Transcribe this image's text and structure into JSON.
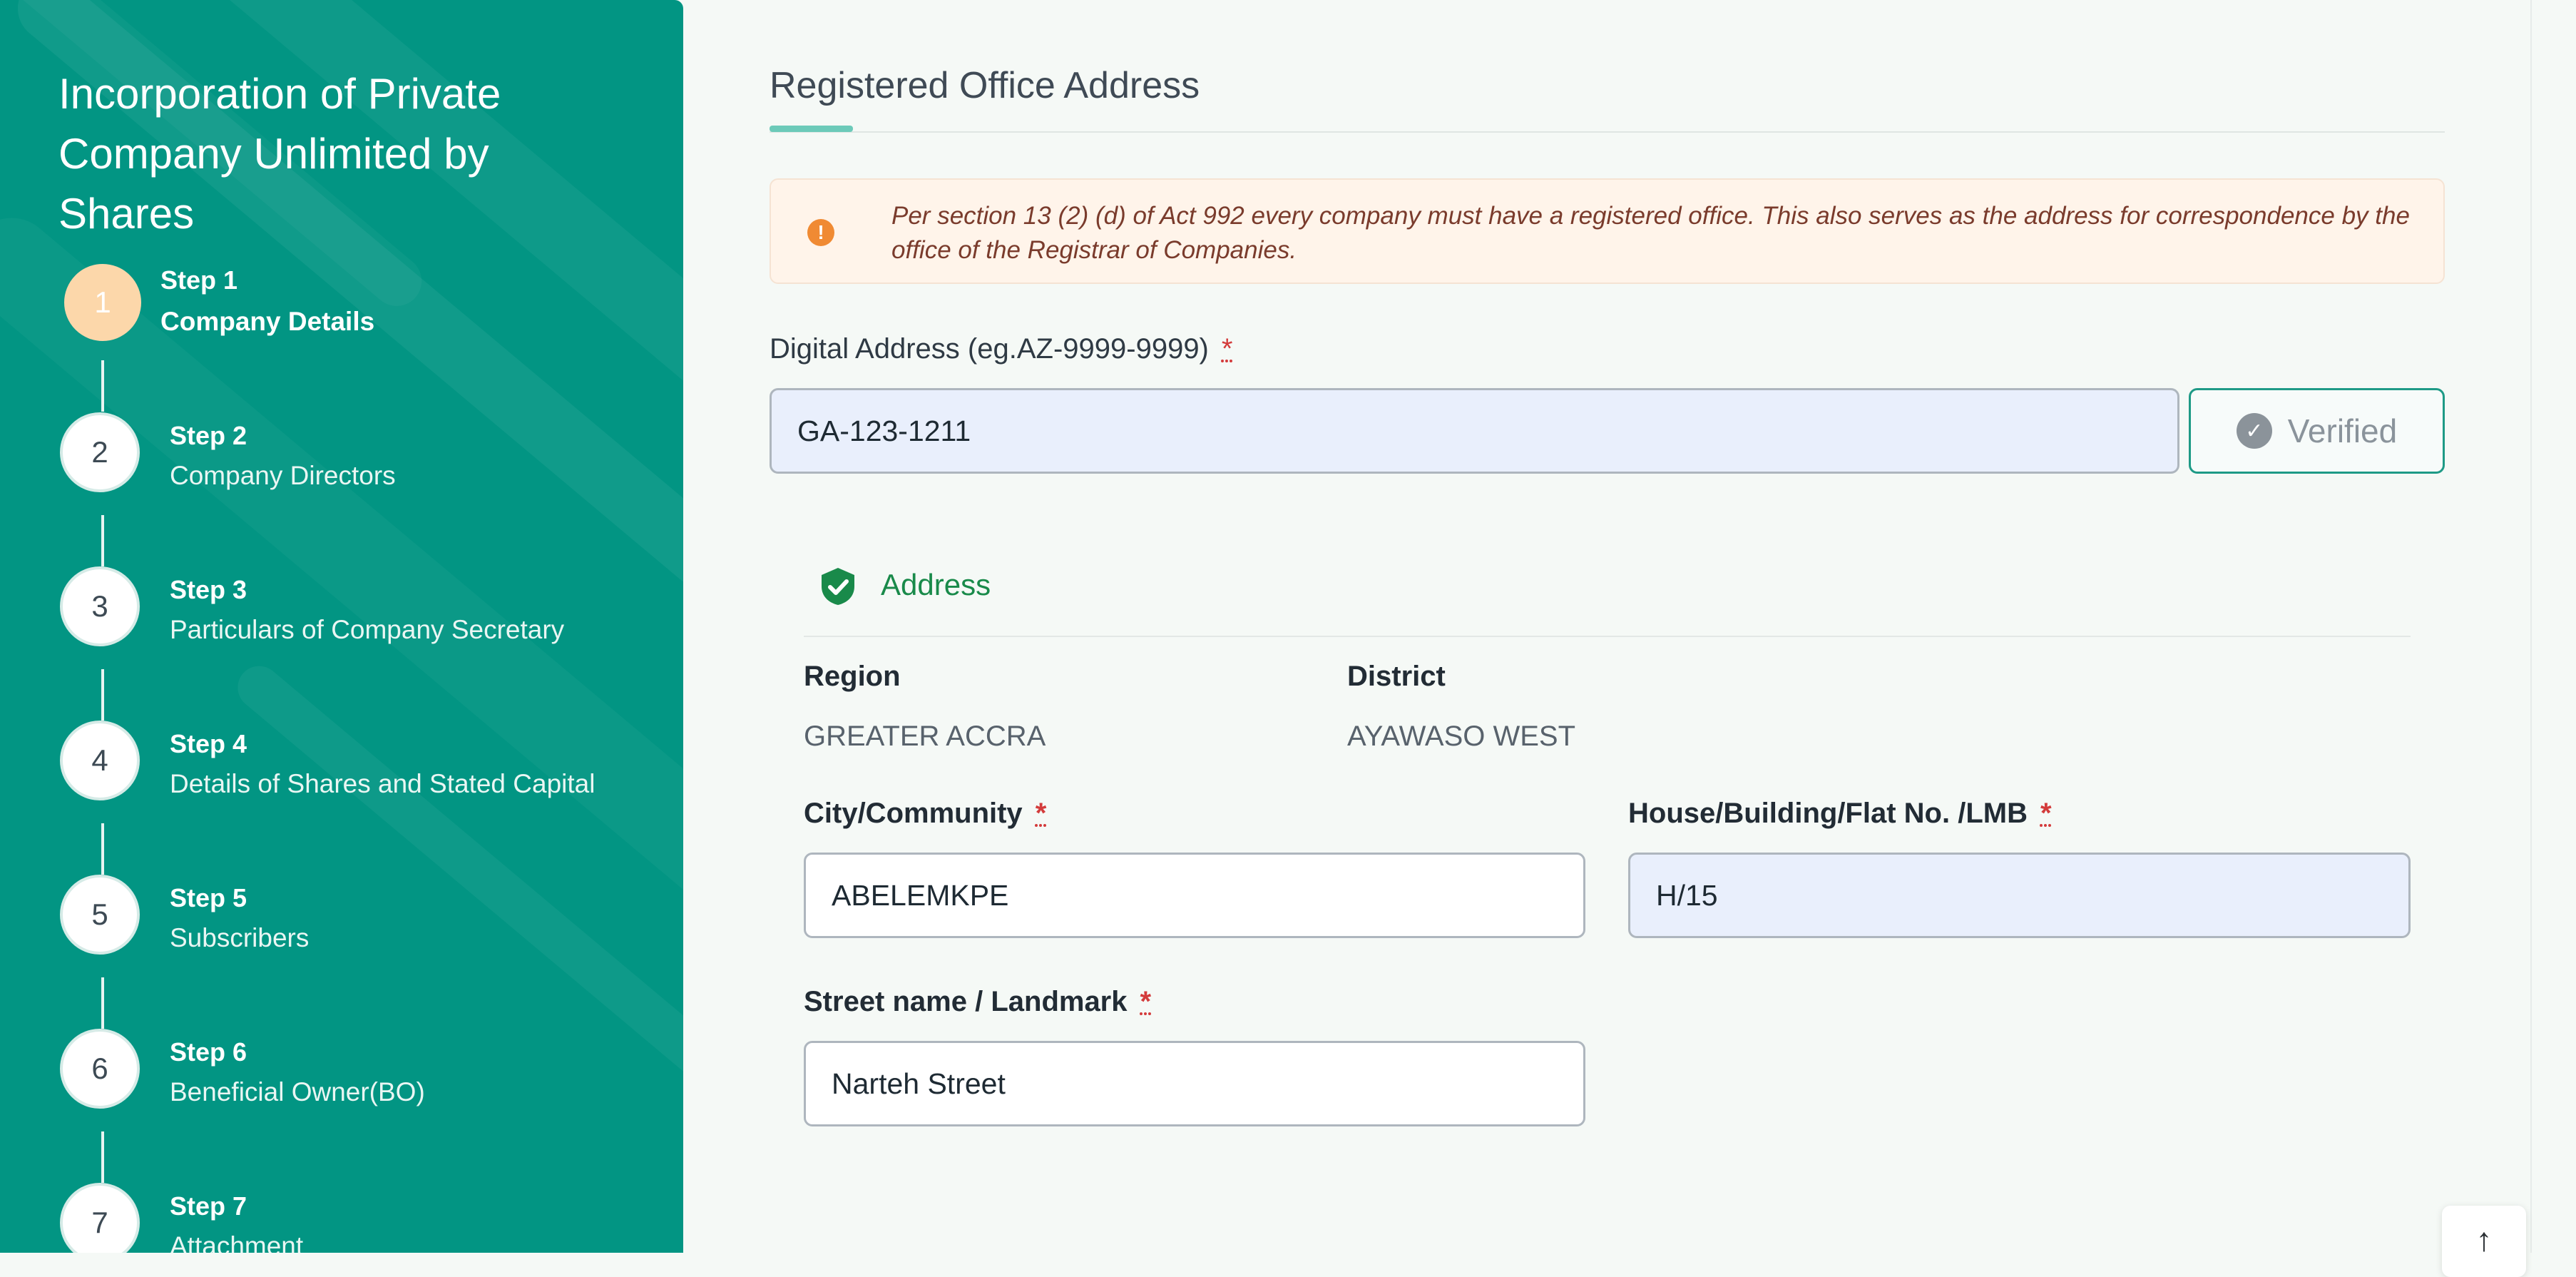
{
  "sidebar": {
    "title": "Incorporation of Private Company Unlimited by Shares",
    "steps": [
      {
        "number": "1",
        "label": "Step 1",
        "name": "Company Details"
      },
      {
        "number": "2",
        "label": "Step 2",
        "name": "Company Directors"
      },
      {
        "number": "3",
        "label": "Step 3",
        "name": "Particulars of Company Secretary"
      },
      {
        "number": "4",
        "label": "Step 4",
        "name": "Details of Shares and Stated Capital"
      },
      {
        "number": "5",
        "label": "Step 5",
        "name": "Subscribers"
      },
      {
        "number": "6",
        "label": "Step 6",
        "name": "Beneficial Owner(BO)"
      },
      {
        "number": "7",
        "label": "Step 7",
        "name": "Attachment"
      }
    ]
  },
  "main": {
    "section_title": "Registered Office Address",
    "notice": "Per section 13 (2) (d) of Act 992 every company must have a registered office. This also serves as the address for correspondence by the office of the Registrar of Companies.",
    "digital_address": {
      "label": "Digital Address (eg.AZ-9999-9999)",
      "required_mark": "*",
      "value": "GA-123-1211",
      "verify_button": "Verified"
    },
    "address": {
      "title": "Address",
      "region_label": "Region",
      "region_value": "GREATER ACCRA",
      "district_label": "District",
      "district_value": "AYAWASO WEST",
      "city_label": "City/Community",
      "city_value": "ABELEMKPE",
      "house_label": "House/Building/Flat No. /LMB",
      "house_value": "H/15",
      "street_label": "Street name / Landmark",
      "street_value": "Narteh Street",
      "required_mark": "*"
    }
  },
  "colors": {
    "sidebar_bg": "#029583",
    "active_step": "#fcd7aa",
    "notice_bg": "#fff4ea",
    "verified_border": "#1e9a86",
    "address_green": "#198a4a",
    "required_red": "#d33b3b"
  },
  "icons": {
    "notice": "exclamation-circle-icon",
    "verified": "check-circle-icon",
    "address": "shield-check-icon",
    "scroll_top": "arrow-up-icon"
  }
}
